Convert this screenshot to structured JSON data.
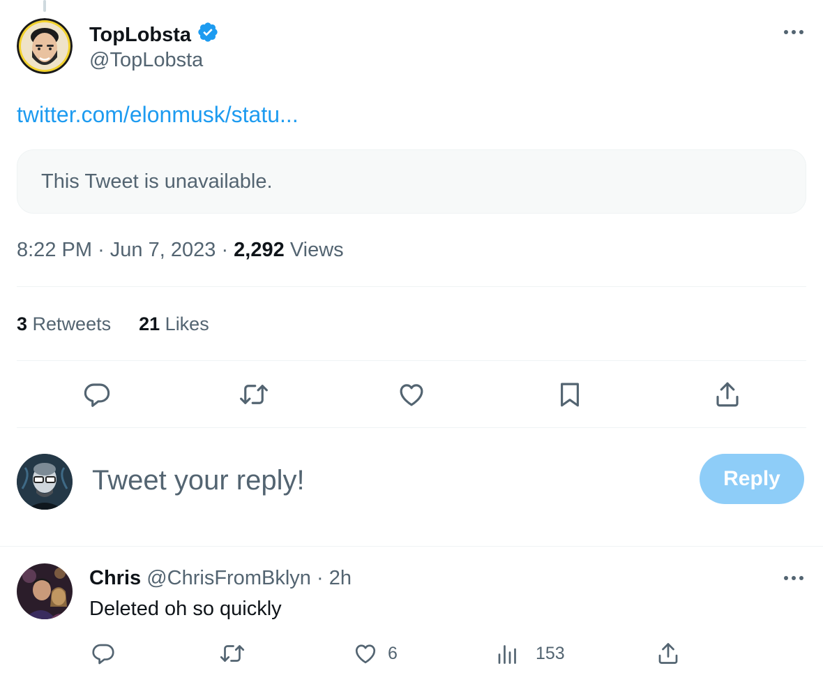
{
  "tweet": {
    "author": {
      "name": "TopLobsta",
      "handle": "@TopLobsta",
      "verified": true
    },
    "link_text": "twitter.com/elonmusk/statu...",
    "quoted_notice": "This Tweet is unavailable.",
    "time": "8:22 PM",
    "date": "Jun 7, 2023",
    "separator": "·",
    "views_count": "2,292",
    "views_label": "Views",
    "retweets_count": "3",
    "retweets_label": "Retweets",
    "likes_count": "21",
    "likes_label": "Likes"
  },
  "composer": {
    "placeholder": "Tweet your reply!",
    "button_label": "Reply"
  },
  "reply": {
    "name": "Chris",
    "handle": "@ChrisFromBklyn",
    "separator": "·",
    "time": "2h",
    "text": "Deleted oh so quickly",
    "likes": "6",
    "views": "153"
  },
  "icons": {
    "reply": "reply-icon",
    "retweet": "retweet-icon",
    "like": "heart-icon",
    "bookmark": "bookmark-icon",
    "share": "share-icon",
    "views": "analytics-icon",
    "more": "more-icon",
    "verified": "verified-badge-icon"
  },
  "colors": {
    "accent": "#1d9bf0",
    "reply_button_disabled": "#8ecdf8",
    "secondary_text": "#536471",
    "primary_text": "#0f1419",
    "divider": "#eff3f4"
  }
}
